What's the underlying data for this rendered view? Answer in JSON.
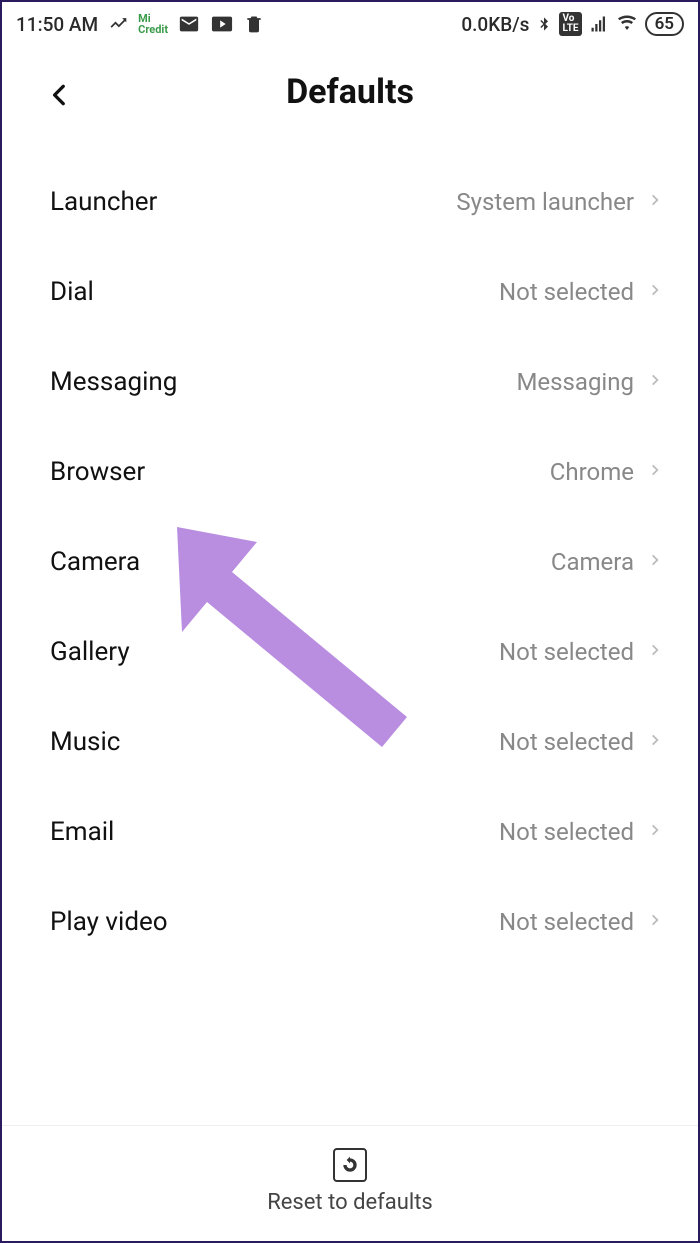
{
  "status_bar": {
    "time": "11:50 AM",
    "data_rate": "0.0KB/s",
    "battery": "65",
    "volte": "VoLTE"
  },
  "header": {
    "title": "Defaults"
  },
  "rows": [
    {
      "label": "Launcher",
      "value": "System launcher"
    },
    {
      "label": "Dial",
      "value": "Not selected"
    },
    {
      "label": "Messaging",
      "value": "Messaging"
    },
    {
      "label": "Browser",
      "value": "Chrome"
    },
    {
      "label": "Camera",
      "value": "Camera"
    },
    {
      "label": "Gallery",
      "value": "Not selected"
    },
    {
      "label": "Music",
      "value": "Not selected"
    },
    {
      "label": "Email",
      "value": "Not selected"
    },
    {
      "label": "Play video",
      "value": "Not selected"
    }
  ],
  "bottom": {
    "reset_label": "Reset to defaults"
  }
}
